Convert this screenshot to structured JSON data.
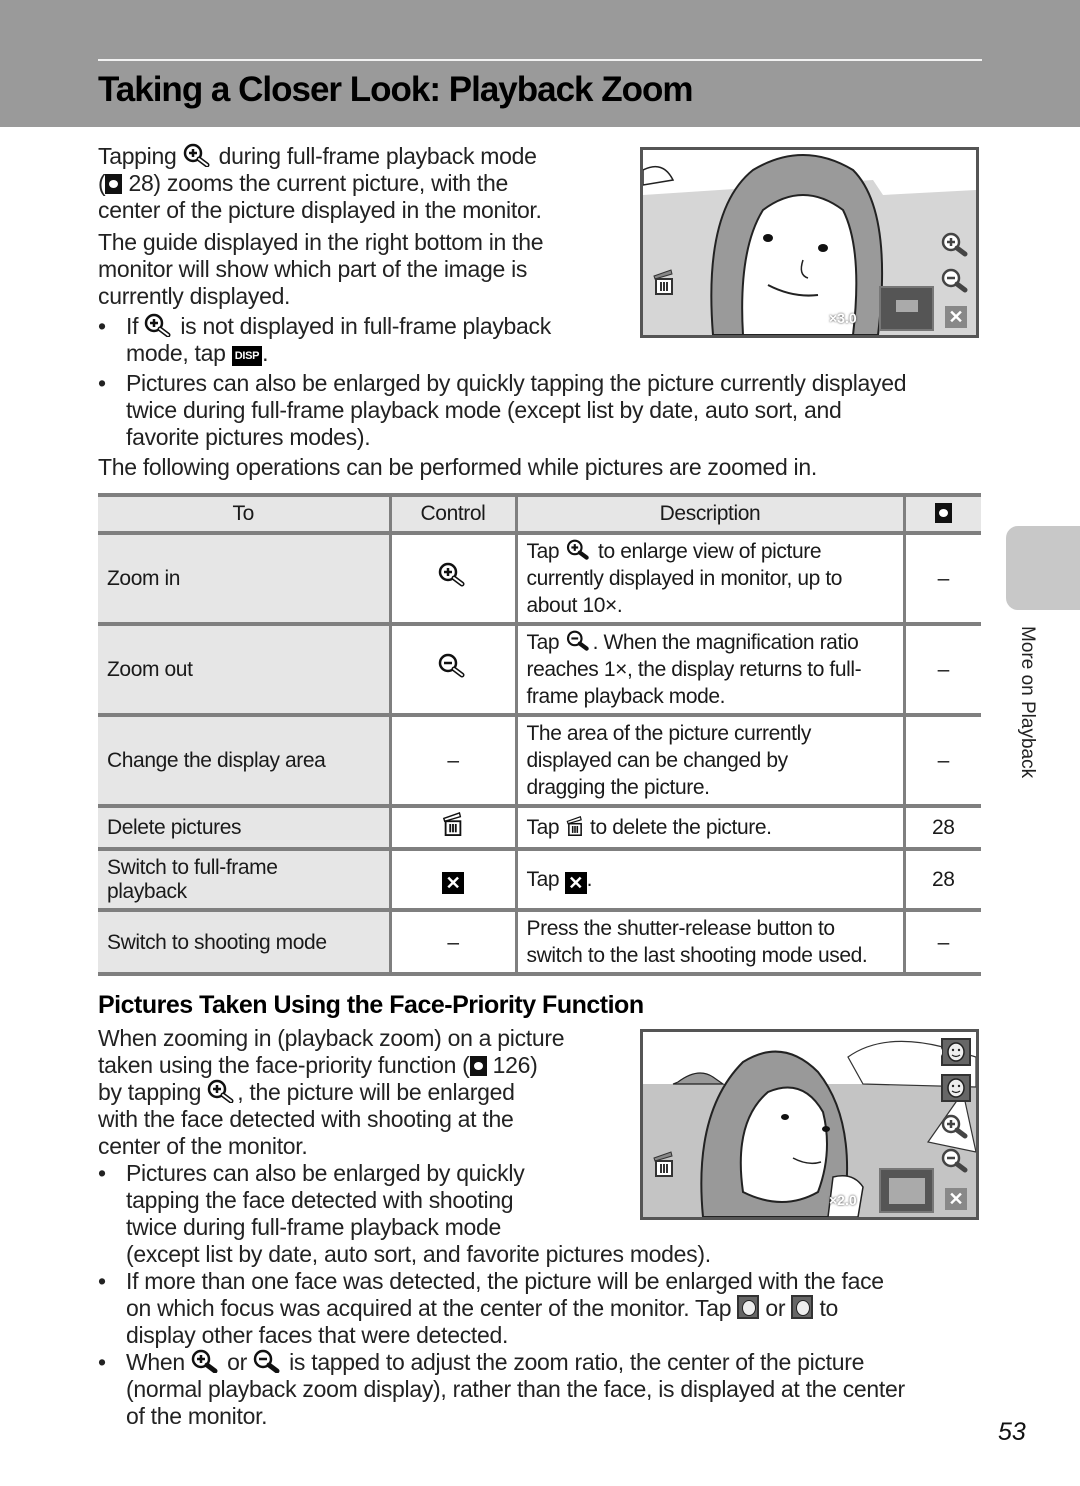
{
  "header": {
    "title": "Taking a Closer Look: Playback Zoom"
  },
  "intro": {
    "p1_lines": [
      [
        "Tapping ",
        "zoom-in-icon",
        " during full-frame playback mode"
      ],
      [
        "(",
        "reference-icon",
        " 28) zooms the current picture, with the"
      ],
      [
        "center of the picture displayed in the monitor."
      ]
    ],
    "p1_a": "Tapping",
    "p1_b": "during full-frame playback mode",
    "p1_c": "(",
    "p1_d": "28) zooms the current picture, with the",
    "p1_e": "center of the picture displayed in the monitor.",
    "p2_l1": "The guide displayed in the right bottom in the",
    "p2_l2": "monitor will show which part of the image is",
    "p2_l3": "currently displayed.",
    "bullet1_a": "If",
    "bullet1_b": "is not displayed in full-frame playback",
    "bullet1_c": "mode, tap",
    "bullet1_d": ".",
    "disp_label": "DISP",
    "bullet2_l1": "Pictures can also be enlarged by quickly tapping the picture currently displayed",
    "bullet2_l2": "twice during full-frame playback mode (except list by date, auto sort, and",
    "bullet2_l3": "favorite pictures modes).",
    "p3": "The following operations can be performed while pictures are zoomed in.",
    "bullet_char": "•"
  },
  "screen1": {
    "zoom_ratio": "×3.0"
  },
  "table": {
    "headers": [
      "To",
      "Control",
      "Description"
    ],
    "rows": [
      {
        "to": "Zoom in",
        "control_icon": "zoom-in-icon",
        "desc_pre": "Tap",
        "desc_icon": "zoom-in-icon",
        "desc_l1": "to enlarge view of picture",
        "desc_l2": "currently displayed in monitor, up to",
        "desc_l3": "about 10×.",
        "ref": "–"
      },
      {
        "to": "Zoom out",
        "control_icon": "zoom-out-icon",
        "desc_pre": "Tap",
        "desc_icon": "zoom-out-icon",
        "desc_l1": ". When the magnification ratio",
        "desc_l2": "reaches 1×, the display returns to full-",
        "desc_l3": "frame playback mode.",
        "ref": "–"
      },
      {
        "to": "Change the display area",
        "control": "–",
        "desc_l1": "The area of the picture currently",
        "desc_l2": "displayed can be changed by",
        "desc_l3": "dragging the picture.",
        "ref": "–"
      },
      {
        "to": "Delete pictures",
        "control_icon": "trash-icon",
        "desc_pre": "Tap",
        "desc_icon": "trash-icon",
        "desc_l1": "to delete the picture.",
        "ref": "28"
      },
      {
        "to_l1": "Switch to full-frame",
        "to_l2": "playback",
        "control_icon": "close-x-icon",
        "desc_pre": "Tap",
        "desc_icon": "close-x-icon",
        "desc_l1": ".",
        "ref": "28"
      },
      {
        "to": "Switch to shooting mode",
        "control": "–",
        "desc_l1": "Press the shutter-release button to",
        "desc_l2": "switch to the last shooting mode used.",
        "ref": "–"
      }
    ],
    "x_glyph": "✕"
  },
  "face_section": {
    "title": "Pictures Taken Using the Face-Priority Function",
    "p_l1": "When zooming in (playback zoom) on a picture",
    "p_l2a": "taken using the face-priority function (",
    "p_l2b": " 126)",
    "p_l3a": "by tapping",
    "p_l3b": ", the picture will be enlarged",
    "p_l4": "with the face detected with shooting at the",
    "p_l5": "center of the monitor.",
    "b1_l1": "Pictures can also be enlarged by quickly",
    "b1_l2": "tapping the face detected with shooting",
    "b1_l3": "twice during full-frame playback mode",
    "b1_l4": "(except list by date, auto sort, and favorite pictures modes).",
    "b2_l1": "If more than one face was detected, the picture will be enlarged with the face",
    "b2_l2a": "on which focus was acquired at the center of the monitor. Tap",
    "b2_l2b": "or",
    "b2_l2c": "to",
    "b2_l3": "display other faces that were detected.",
    "b3_l1a": "When",
    "b3_l1b": "or",
    "b3_l1c": "is tapped to adjust the zoom ratio, the center of the picture",
    "b3_l2": "(normal playback zoom display), rather than the face, is displayed at the center",
    "b3_l3": "of the monitor."
  },
  "screen2": {
    "zoom_ratio": "×2.0"
  },
  "side_tab": {
    "label": "More on Playback"
  },
  "footer": {
    "page_number": "53"
  }
}
